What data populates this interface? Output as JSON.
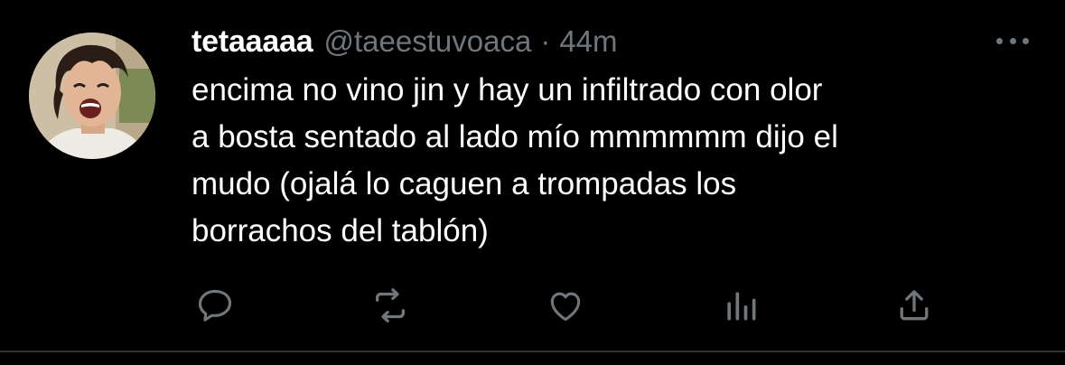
{
  "tweet": {
    "display_name": "tetaaaaa",
    "handle": "@taeestuvoaca",
    "separator": "·",
    "time": "44m",
    "text_lines": [
      "encima no vino jin y hay un infiltrado con olor",
      "a bosta sentado al lado mío mmmmmm dijo el",
      "mudo (ojalá lo caguen a trompadas los",
      "borrachos del tablón)"
    ]
  },
  "actions": {
    "reply_icon": "reply-icon",
    "retweet_icon": "retweet-icon",
    "like_icon": "heart-icon",
    "analytics_icon": "analytics-icon",
    "share_icon": "share-icon"
  },
  "colors": {
    "background": "#000000",
    "text": "#ffffff",
    "secondary": "#71767b",
    "divider": "#2f3336"
  }
}
